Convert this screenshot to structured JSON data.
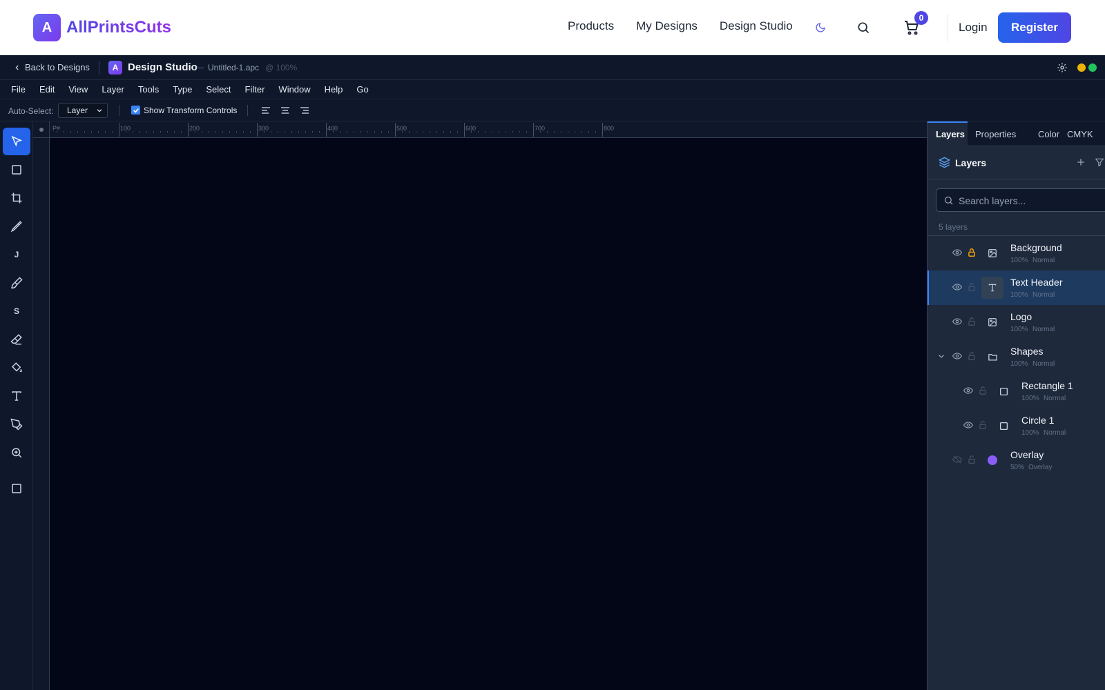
{
  "site": {
    "brand_letter": "A",
    "brand_name": "AllPrintsCuts",
    "nav": [
      "Products",
      "My Designs",
      "Design Studio"
    ],
    "cart_count": "0",
    "login": "Login",
    "register": "Register"
  },
  "studio": {
    "back": "Back to Designs",
    "logo_letter": "A",
    "title": "Design Studio",
    "dash": "—",
    "file": "Untitled-1.apc",
    "zoom": "@ 100%",
    "status_colors": [
      "#eab308",
      "#22c55e"
    ]
  },
  "menu": [
    "File",
    "Edit",
    "View",
    "Layer",
    "Tools",
    "Type",
    "Select",
    "Filter",
    "Window",
    "Help",
    "Go"
  ],
  "options": {
    "auto_select_label": "Auto-Select:",
    "auto_select_value": "Layer",
    "show_transform": "Show Transform Controls",
    "show_transform_checked": true
  },
  "tools": {
    "letter_j": "J",
    "letter_s": "S"
  },
  "ruler": {
    "origin": "P#",
    "ticks": [
      "100",
      "200",
      "300",
      "400",
      "500",
      "600",
      "700",
      "800"
    ]
  },
  "panel": {
    "tabs": [
      "Layers",
      "Properties",
      "Color",
      "CMYK"
    ],
    "active_tab": "Layers",
    "layers_title": "Layers",
    "search_placeholder": "Search layers...",
    "layer_count": "5 layers",
    "layers": [
      {
        "name": "Background",
        "opacity": "100%",
        "blend": "Normal",
        "icon": "image-icon",
        "locked": true,
        "visible": true
      },
      {
        "name": "Text Header",
        "opacity": "100%",
        "blend": "Normal",
        "icon": "text-icon",
        "locked": false,
        "visible": true,
        "selected": true
      },
      {
        "name": "Logo",
        "opacity": "100%",
        "blend": "Normal",
        "icon": "image-icon",
        "locked": false,
        "visible": true
      },
      {
        "name": "Shapes",
        "opacity": "100%",
        "blend": "Normal",
        "icon": "folder-icon",
        "locked": false,
        "visible": true,
        "expanded": true
      },
      {
        "name": "Rectangle 1",
        "opacity": "100%",
        "blend": "Normal",
        "icon": "square-icon",
        "locked": false,
        "visible": true,
        "child": true
      },
      {
        "name": "Circle 1",
        "opacity": "100%",
        "blend": "Normal",
        "icon": "square-icon",
        "locked": false,
        "visible": true,
        "child": true
      },
      {
        "name": "Overlay",
        "opacity": "50%",
        "blend": "Overlay",
        "icon": "color-dot-icon",
        "locked": false,
        "visible": false
      }
    ],
    "accent": "#3b82f6",
    "lock_color": "#f59e0b",
    "overlay_color": "#8b5cf6"
  }
}
